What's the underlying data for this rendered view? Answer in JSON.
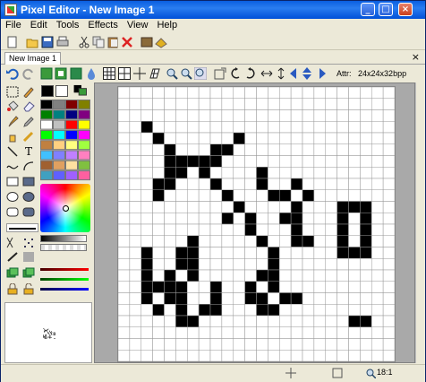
{
  "window": {
    "title": "Pixel Editor - New Image 1"
  },
  "titlebar_buttons": {
    "minimize": "_",
    "maximize": "□",
    "close": "×"
  },
  "menu": [
    "File",
    "Edit",
    "Tools",
    "Effects",
    "View",
    "Help"
  ],
  "tab": {
    "label": "New Image 1",
    "close": "×"
  },
  "attributes": {
    "label": "Attr:",
    "value": "24x24x32bpp"
  },
  "status": {
    "zoom": "18:1"
  },
  "palette": [
    "#000000",
    "#808080",
    "#800000",
    "#808000",
    "#008000",
    "#008080",
    "#000080",
    "#800080",
    "#ffffff",
    "#c0c0c0",
    "#ff0000",
    "#ffff00",
    "#00ff00",
    "#00ffff",
    "#0000ff",
    "#ff00ff",
    "#c08040",
    "#ffd080",
    "#ffff80",
    "#a0ff40",
    "#40c0ff",
    "#8080ff",
    "#c080ff",
    "#ff80c0",
    "#a06030",
    "#e0a060",
    "#ffe0a0",
    "#80c040",
    "#40a0c0",
    "#6060ff",
    "#a060ff",
    "#ff60a0"
  ],
  "colors": {
    "primary": "#000000",
    "secondary": "#ffffff",
    "title_gradient_start": "#0a5ee0",
    "canvas_bg": "#ffffff",
    "pixel": "#000000"
  },
  "image": {
    "width": 24,
    "height": 24,
    "rows": [
      "........................",
      "........................",
      "........................",
      "..#.....................",
      "...#......#.............",
      "....#...##..............",
      "....#####...............",
      "....##.#....#...........",
      "...##...#...#..#........",
      "...#.....#...##.#.......",
      "..........#....#...###..",
      ".........#.#..##...#.#..",
      "...........#...#...#.#..",
      "......#.....#..##..#.#..",
      "..#..##......#.....###..",
      "..#..##......#..........",
      "..#.#.#.....##..........",
      "..####..#..#.#..........",
      "..#.##..#..##.##........",
      "...#.#.##...##..........",
      ".....##.............##..",
      "........................",
      "........................",
      "........................"
    ]
  }
}
